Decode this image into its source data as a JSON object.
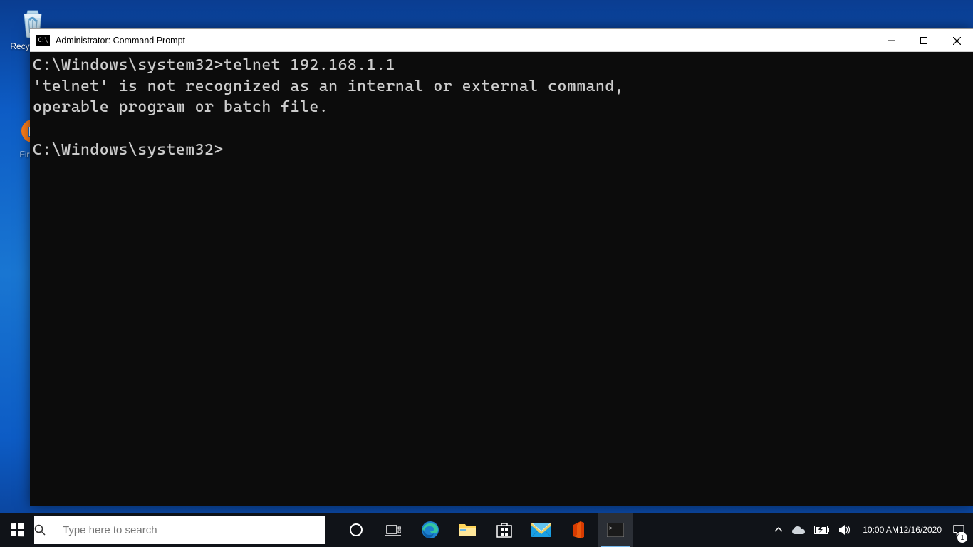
{
  "desktop": {
    "icons": {
      "recycle_bin_label": "Recycle Bin",
      "firefox_label": "Firefox"
    }
  },
  "window": {
    "title": "Administrator: Command Prompt",
    "terminal_lines": {
      "l1": "C:\\Windows\\system32>telnet 192.168.1.1",
      "l2": "'telnet' is not recognized as an internal or external command,",
      "l3": "operable program or batch file.",
      "l4": "",
      "l5": "C:\\Windows\\system32>"
    }
  },
  "taskbar": {
    "search_placeholder": "Type here to search",
    "clock_time": "10:00 AM",
    "clock_date": "12/16/2020",
    "notification_count": "1"
  }
}
